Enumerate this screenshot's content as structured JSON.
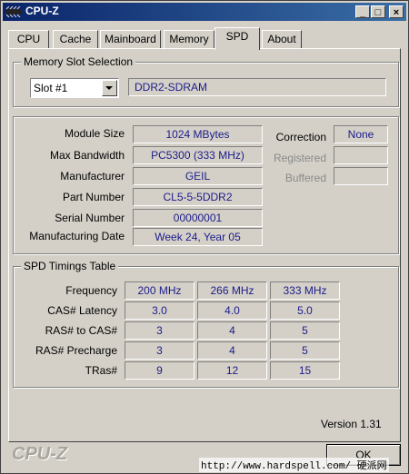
{
  "window": {
    "title": "CPU-Z",
    "buttons": {
      "minimize": "_",
      "maximize": "□",
      "close": "×"
    }
  },
  "tabs": [
    {
      "label": "CPU",
      "active": false
    },
    {
      "label": "Cache",
      "active": false
    },
    {
      "label": "Mainboard",
      "active": false
    },
    {
      "label": "Memory",
      "active": false
    },
    {
      "label": "SPD",
      "active": true
    },
    {
      "label": "About",
      "active": false
    }
  ],
  "slot_selection": {
    "legend": "Memory Slot Selection",
    "selected_slot": "Slot #1",
    "memory_type": "DDR2-SDRAM"
  },
  "module_info": {
    "module_size_label": "Module Size",
    "module_size": "1024 MBytes",
    "max_bandwidth_label": "Max Bandwidth",
    "max_bandwidth": "PC5300 (333 MHz)",
    "manufacturer_label": "Manufacturer",
    "manufacturer": "GEIL",
    "part_number_label": "Part Number",
    "part_number": "CL5-5-5DDR2",
    "serial_number_label": "Serial Number",
    "serial_number": "00000001",
    "manufacturing_date_label": "Manufacturing Date",
    "manufacturing_date": "Week 24, Year 05",
    "correction_label": "Correction",
    "correction": "None",
    "registered_label": "Registered",
    "registered": "",
    "buffered_label": "Buffered",
    "buffered": ""
  },
  "timings": {
    "legend": "SPD Timings Table",
    "row_labels": [
      "Frequency",
      "CAS# Latency",
      "RAS# to CAS#",
      "RAS# Precharge",
      "TRas#"
    ],
    "columns": [
      [
        "200 MHz",
        "3.0",
        "3",
        "3",
        "9"
      ],
      [
        "266 MHz",
        "4.0",
        "4",
        "4",
        "12"
      ],
      [
        "333 MHz",
        "5.0",
        "5",
        "5",
        "15"
      ]
    ]
  },
  "footer": {
    "version": "Version 1.31",
    "brand": "CPU-Z",
    "ok_label": "OK",
    "watermark": "http://www.hardspell.com/ 硬派网"
  }
}
